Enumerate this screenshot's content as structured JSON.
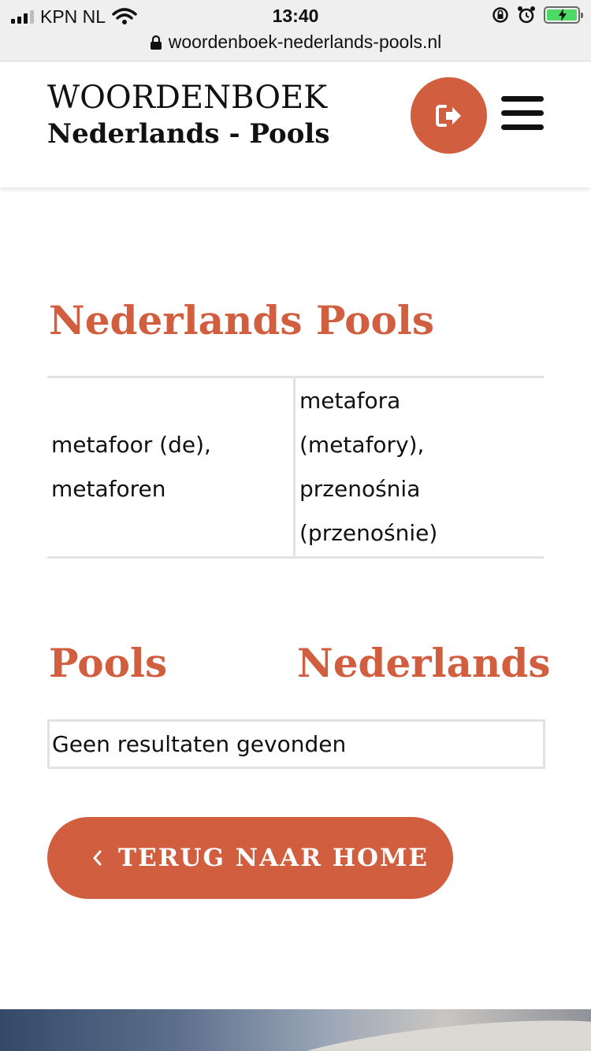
{
  "status_bar": {
    "carrier": "KPN NL",
    "time": "13:40",
    "url": "woordenboek-nederlands-pools.nl"
  },
  "header": {
    "logo_line1": "WOORDENBOEK",
    "logo_line2": "Nederlands - Pools"
  },
  "section_nl_pl": {
    "title": "Nederlands Pools",
    "row": {
      "dutch_line1": "metafoor (de),",
      "dutch_line2": "metaforen",
      "polish_line1": "metafora",
      "polish_line2": "(metafory),",
      "polish_line3": "przenośnia",
      "polish_line4": "(przenośnie)"
    }
  },
  "section_pl_nl": {
    "title_left": "Pools",
    "title_right": "Nederlands",
    "empty_text": "Geen resultaten gevonden"
  },
  "home_button": {
    "chevron": "‹",
    "label": "TERUG NAAR HOME"
  },
  "colors": {
    "accent": "#d05e3f",
    "battery": "#4cd964"
  }
}
